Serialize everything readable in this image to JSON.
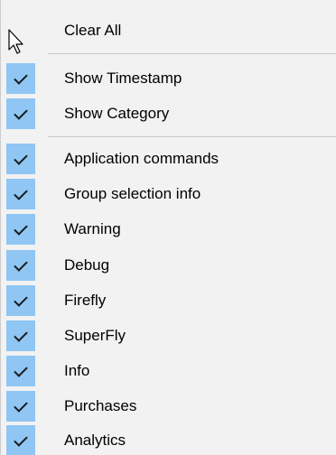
{
  "menu": {
    "top_items": [
      {
        "label": "Clear All",
        "checked": false
      }
    ],
    "view_items": [
      {
        "label": "Show Timestamp",
        "checked": true
      },
      {
        "label": "Show Category",
        "checked": true
      }
    ],
    "category_items": [
      {
        "label": "Application commands",
        "checked": true
      },
      {
        "label": "Group selection info",
        "checked": true
      },
      {
        "label": "Warning",
        "checked": true
      },
      {
        "label": "Debug",
        "checked": true
      },
      {
        "label": "Firefly",
        "checked": true
      },
      {
        "label": "SuperFly",
        "checked": true
      },
      {
        "label": "Info",
        "checked": true
      },
      {
        "label": "Purchases",
        "checked": true
      },
      {
        "label": "Analytics",
        "checked": true
      }
    ]
  },
  "icons": {
    "check": "check-icon",
    "pointer": "mouse-pointer-icon"
  },
  "colors": {
    "menu_background": "#f2f2f2",
    "check_gutter": "#8fc6f4",
    "separator": "#c8c8c8",
    "text": "#000000"
  }
}
